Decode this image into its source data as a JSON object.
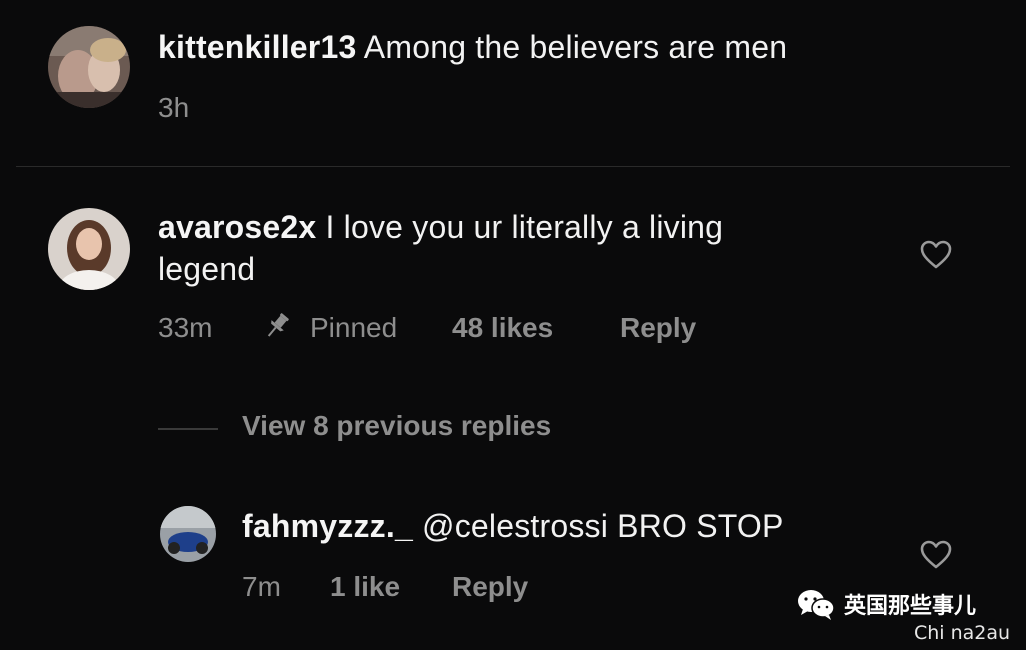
{
  "comments": [
    {
      "username": "kittenkiller13",
      "text": "Among the believers are men",
      "time": "3h"
    },
    {
      "username": "avarose2x",
      "text_line1": "I love you ur literally a living",
      "text_line2": "legend",
      "time": "33m",
      "pinned_label": "Pinned",
      "likes": "48 likes",
      "reply_label": "Reply",
      "view_replies": "View 8 previous replies"
    },
    {
      "username": "fahmyzzz._",
      "text": "@celestrossi BRO STOP",
      "time": "7m",
      "likes": "1 like",
      "reply_label": "Reply"
    }
  ],
  "watermark": {
    "channel": "英国那些事儿",
    "site": "Chi na2au",
    "icon": "wechat-icon"
  },
  "colors": {
    "background": "#0a0a0b",
    "text": "#f2f2f2",
    "meta": "#8e8e8e"
  }
}
